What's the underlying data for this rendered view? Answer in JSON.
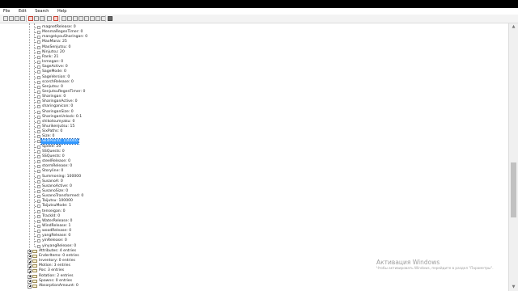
{
  "menu": [
    "File",
    "Edit",
    "Search",
    "Help"
  ],
  "toolbar_icons": [
    "new-file-icon",
    "open-folder-icon",
    "save-icon",
    "save-all-icon",
    "delete-icon",
    "copy-icon",
    "paste-icon",
    "edit-icon",
    "remove-icon",
    "tool-icon-1",
    "tool-icon-2",
    "tool-icon-3",
    "tool-icon-4",
    "tool-icon-5",
    "tool-icon-6",
    "tool-icon-7",
    "tool-icon-8",
    "grid-icon"
  ],
  "tree": {
    "selected_index": 23,
    "leaves": [
      "magnetRelease: 0",
      "MenmaRegenTimer: 0",
      "mangekyouSharingan: 0",
      "MaxMana: 25",
      "MaxSenjutsu: 0",
      "Ninjutsu: 20",
      "Rank: 21",
      "Inmegan: 0",
      "SageActive: 0",
      "SageMode: 0",
      "SageVersion: 0",
      "scorchRelease: 0",
      "Senjutsu: 0",
      "SenjutsuRegenTimer: 0",
      "Sharingan: 0",
      "SharinganActive: 0",
      "sharinganicon: 0",
      "SharinganSize: 0",
      "SharinganUnlock: 0.1",
      "shikotsumyaku: 0",
      "Shurikenjutsu: 15",
      "SixPaths: 0",
      "Size: 0",
      "SkillPoints: 100000",
      "Speed: 20",
      "SSQuests: 0",
      "SSQuests: 0",
      "steelRelease: 0",
      "stormRelease: 0",
      "Storyline: 0",
      "Summoning: 100000",
      "SusanoA: 0",
      "SusanoActive: 0",
      "SusanoSize: 0",
      "SusanoTransformed: 0",
      "Taijutsu: 100000",
      "TaijutsuMode: 1",
      "tenseigan: 0",
      "TrackId: 0",
      "WaterRelease: 0",
      "WindRelease: 1",
      "woodRelease: 0",
      "yangRelease: 0",
      "yinRelease: 0",
      "yinyangRelease: 0"
    ],
    "groups": [
      "Attributes: 4 entries",
      "EnderItems: 0 entries",
      "Inventory: 0 entries",
      "Motion: 3 entries",
      "Pos: 3 entries",
      "Rotation: 2 entries",
      "Spawns: 0 entries",
      "AbsorptionAmount: 0"
    ]
  },
  "watermark": {
    "title": "Активация Windows",
    "subtitle": "Чтобы активировать Windows, перейдите в раздел \"Параметры\"."
  },
  "colors": {
    "selection": "#3399ff",
    "background": "#ffffff",
    "frame": "#000000"
  }
}
